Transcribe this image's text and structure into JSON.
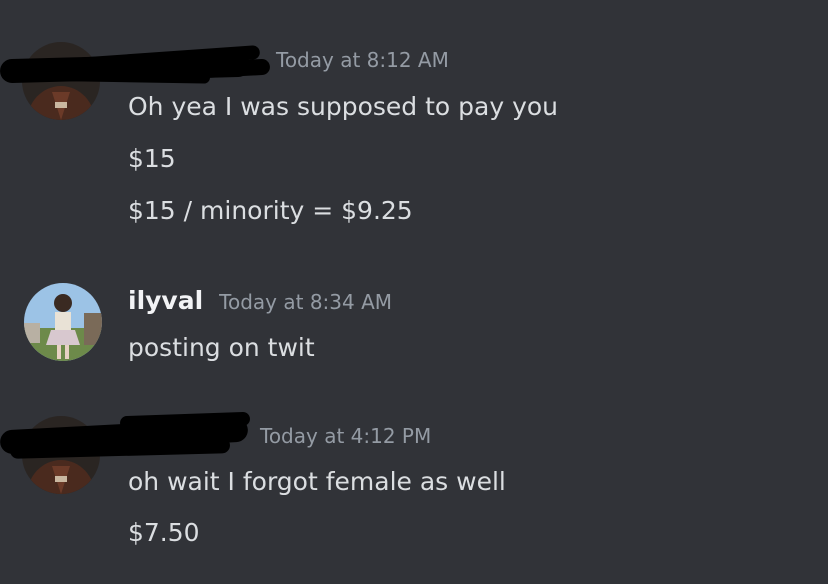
{
  "messages": [
    {
      "username": "",
      "timestamp": "Today at 8:12 AM",
      "lines": [
        "Oh yea I was supposed to pay you",
        "$15",
        "$15 / minority = $9.25"
      ]
    },
    {
      "username": "ilyval",
      "timestamp": "Today at 8:34 AM",
      "lines": [
        "posting on twit"
      ]
    },
    {
      "username": "",
      "timestamp": "Today at 4:12 PM",
      "lines": [
        "oh wait I forgot female as well",
        "$7.50"
      ]
    }
  ],
  "colors": {
    "background": "#313338",
    "username": "#f2f3f5",
    "timestamp": "#949ba4",
    "text": "#dbdee1",
    "redaction": "#000000"
  }
}
